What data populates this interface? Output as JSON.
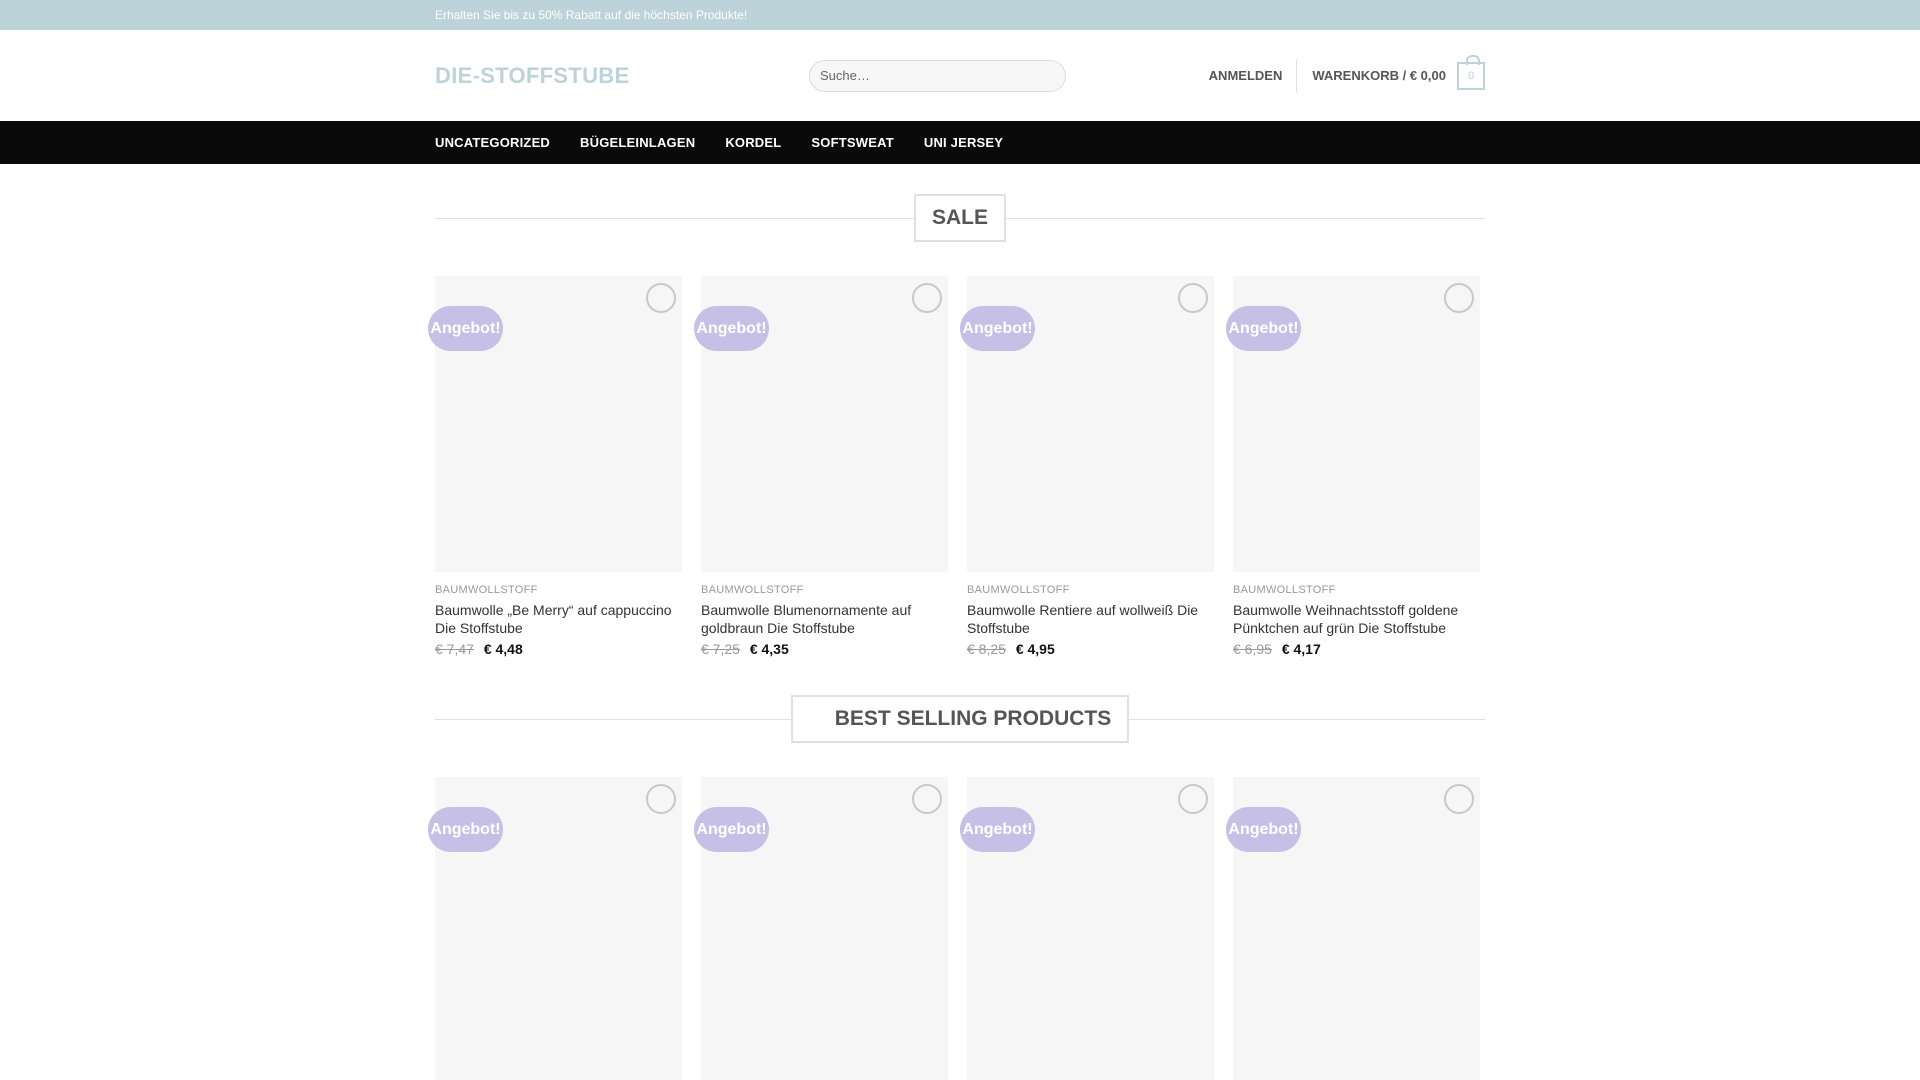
{
  "topbar": {
    "text": "Erhalten Sie bis zu 50% Rabatt auf die höchsten Produkte!"
  },
  "header": {
    "logo": "DIE-STOFFSTUBE",
    "search_placeholder": "Suche…",
    "login": "ANMELDEN",
    "cart_label": "WARENKORB / € 0,00",
    "cart_count": "0"
  },
  "nav": {
    "items": [
      "UNCATEGORIZED",
      "BÜGELEINLAGEN",
      "KORDEL",
      "SOFTSWEAT",
      "UNI JERSEY"
    ]
  },
  "sale": {
    "title": "SALE",
    "products": [
      {
        "badge": "Angebot!",
        "category": "BAUMWOLLSTOFF",
        "name": "Baumwolle „Be Merry“ auf cappuccino Die Stoffstube",
        "old_price": "€ 7,47",
        "price": "€ 4,48"
      },
      {
        "badge": "Angebot!",
        "category": "BAUMWOLLSTOFF",
        "name": "Baumwolle Blumenornamente auf goldbraun Die Stoffstube",
        "old_price": "€ 7,25",
        "price": "€ 4,35"
      },
      {
        "badge": "Angebot!",
        "category": "BAUMWOLLSTOFF",
        "name": "Baumwolle Rentiere auf wollweiß Die Stoffstube",
        "old_price": "€ 8,25",
        "price": "€ 4,95"
      },
      {
        "badge": "Angebot!",
        "category": "BAUMWOLLSTOFF",
        "name": "Baumwolle Weihnachtsstoff goldene Pünktchen auf grün Die Stoffstube",
        "old_price": "€ 6,95",
        "price": "€ 4,17"
      }
    ]
  },
  "best": {
    "title": "BEST SELLING PRODUCTS",
    "products": [
      {
        "badge": "Angebot!"
      },
      {
        "badge": "Angebot!"
      },
      {
        "badge": "Angebot!"
      },
      {
        "badge": "Angebot!"
      }
    ]
  },
  "colors": {
    "accent": "#bcd3da",
    "badge": "#c6bfe6",
    "nav_bg": "#0a0a0a"
  }
}
